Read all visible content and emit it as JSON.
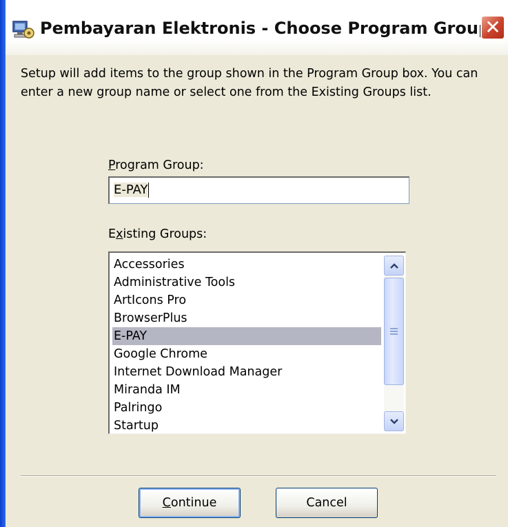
{
  "window": {
    "title": "Pembayaran Elektronis - Choose Program Group",
    "close_glyph": "✕"
  },
  "description": "Setup will add items to the group shown in the Program Group box. You can enter a new group name or select one from the Existing Groups list.",
  "program_group": {
    "label_accel": "P",
    "label_rest": "rogram Group:",
    "value": "E-PAY"
  },
  "existing_groups": {
    "label_pre": "E",
    "label_accel": "x",
    "label_rest": "isting Groups:",
    "items": [
      "Accessories",
      "Administrative Tools",
      "ArtIcons Pro",
      "BrowserPlus",
      "E-PAY",
      "Google Chrome",
      "Internet Download Manager",
      "Miranda IM",
      "Palringo",
      "Startup"
    ],
    "selected_index": 4
  },
  "buttons": {
    "continue_accel": "C",
    "continue_rest": "ontinue",
    "cancel": "Cancel"
  },
  "icons": {
    "app": "installer-computer-icon",
    "scroll_up": "scroll-up-arrow-icon",
    "scroll_down": "scroll-down-arrow-icon"
  },
  "colors": {
    "dialog_bg": "#ece9d8",
    "selection_bg": "#b5b6c4",
    "close_red": "#c9432d"
  }
}
